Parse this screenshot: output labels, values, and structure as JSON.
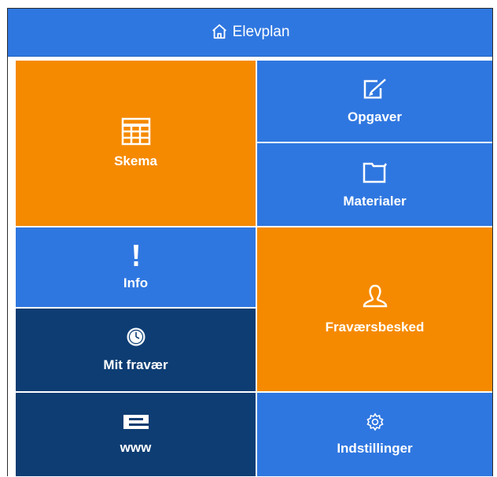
{
  "header": {
    "title": "Elevplan",
    "icon": "home-icon"
  },
  "tiles": {
    "skema": {
      "label": "Skema",
      "icon": "table-icon",
      "color": "#f58a00"
    },
    "opgaver": {
      "label": "Opgaver",
      "icon": "edit-icon",
      "color": "#2f77e0"
    },
    "materialer": {
      "label": "Materialer",
      "icon": "folder-icon",
      "color": "#2f77e0"
    },
    "info": {
      "label": "Info",
      "icon": "exclamation-icon",
      "color": "#2f77e0"
    },
    "fravaersbesked": {
      "label": "Fraværsbesked",
      "icon": "user-icon",
      "color": "#f58a00"
    },
    "mit_fravaer": {
      "label": "Mit fravær",
      "icon": "clock-icon",
      "color": "#0d3d73"
    },
    "www": {
      "label": "www",
      "icon": "e-logo-icon",
      "color": "#0d3d73"
    },
    "indstillinger": {
      "label": "Indstillinger",
      "icon": "gear-icon",
      "color": "#2f77e0"
    }
  }
}
